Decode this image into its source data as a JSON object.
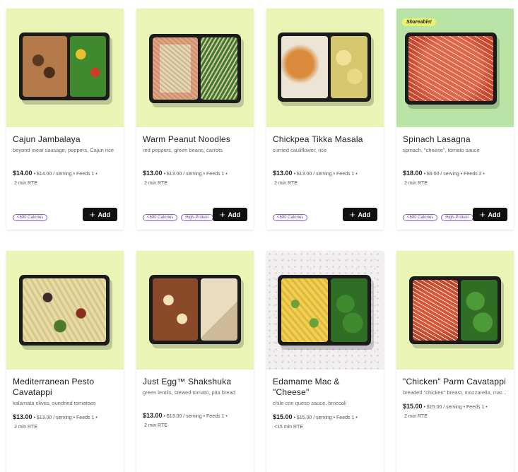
{
  "meals": [
    {
      "title": "Cajun Jambalaya",
      "description": "beyond meat sausage, peppers, Cajun rice",
      "price": "$14.00",
      "details": "• $14.00 / serving • Feeds 1 •",
      "rte": "2 min RTE",
      "badges": [
        "<600 Calories"
      ],
      "add_label": "Add",
      "bg": "lime"
    },
    {
      "title": "Warm Peanut Noodles",
      "description": "red peppers, green beans, carrots",
      "price": "$13.00",
      "details": "• $13.00 / serving • Feeds 1 •",
      "rte": "2 min RTE",
      "badges": [
        "<600 Calories",
        "High-Protein"
      ],
      "add_label": "Add",
      "bg": "lime"
    },
    {
      "title": "Chickpea Tikka Masala",
      "description": "curried cauliflower, rice",
      "price": "$13.00",
      "details": "• $13.00 / serving • Feeds 1 •",
      "rte": "2 min RTE",
      "badges": [
        "<600 Calories"
      ],
      "add_label": "Add",
      "bg": "lime"
    },
    {
      "title": "Spinach Lasagna",
      "description": "spinach, \"cheese\", tomato sauce",
      "price": "$18.00",
      "details": "• $9.00 / serving • Feeds 2 •",
      "rte": "2 min RTE",
      "badges": [
        "<600 Calories",
        "High-Protein"
      ],
      "add_label": "Add",
      "tag": "Shareable!",
      "bg": "green"
    },
    {
      "title": "Mediterranean Pesto Cavatappi",
      "description": "kalamata olives, sundried tomatoes",
      "price": "$13.00",
      "details": "• $13.00 / serving • Feeds 1 •",
      "rte": "2 min RTE",
      "bg": "lime"
    },
    {
      "title": "Just Egg™ Shakshuka",
      "description": "green lentils, stewed tomato, pita bread",
      "price": "$13.00",
      "details": "• $13.00 / serving • Feeds 1 •",
      "rte": "2 min RTE",
      "bg": "lime"
    },
    {
      "title": "Edamame Mac & \"Cheese\"",
      "description": "chile con queso sauce, broccoli",
      "price": "$15.00",
      "details": "• $15.00 / serving • Feeds 1 •",
      "rte": "<15 min RTE",
      "bg": "speckle"
    },
    {
      "title": "\"Chicken\" Parm Cavatappi",
      "description": "breaded \"chicken\" breast, mozzarella, mar...",
      "price": "$15.00",
      "details": "• $15.00 / serving • Feeds 1 •",
      "rte": "2 min RTE",
      "bg": "lime"
    }
  ]
}
